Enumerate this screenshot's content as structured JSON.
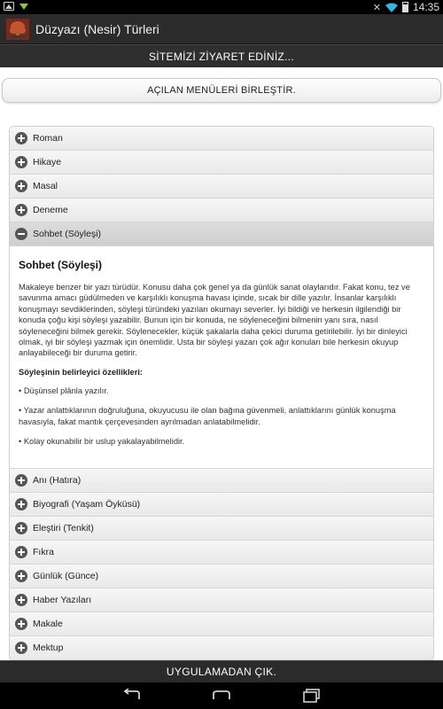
{
  "status_bar": {
    "time": "14:35",
    "icons": [
      "image-icon",
      "download-icon",
      "mute-icon",
      "wifi-icon",
      "battery-icon"
    ]
  },
  "action_bar": {
    "title": "Düzyazı (Nesir) Türleri",
    "icon": "app-logo-icon"
  },
  "visit_banner": {
    "label": "SİTEMİZİ ZİYARET EDİNİZ..."
  },
  "merge_button": {
    "label": "AÇILAN MENÜLERİ BİRLEŞTİR."
  },
  "accordion": {
    "items_before": [
      {
        "label": "Roman"
      },
      {
        "label": "Hikaye"
      },
      {
        "label": "Masal"
      },
      {
        "label": "Deneme"
      }
    ],
    "active_item": {
      "label": "Sohbet (Söyleşi)",
      "content": {
        "title": "Sohbet (Söyleşi)",
        "paragraph": "Makaleye benzer bir yazı türüdür. Konusu daha çok genel ya da günlük sanat olaylarıdır. Fakat konu, tez ve savunma amacı güdülmeden ve karşılıklı konuşma havası içinde, sıcak bir dille yazılır. İnsanlar karşılıklı konuşmayı sevdiklerinden, söyleşi türündeki yazıları okumayı severler. İyi bildiği ve herkesin ilgilendiği bir konuda çoğu kişi söyleşi yazabilir. Bunun için bir konuda, ne söyleneceğini bilmenin yanı sıra, nasıl söyleneceğini bilmek gerekir. Söylenecekler, küçük şakalarla daha çekici duruma getirilebilir. İyi bir dinleyici olmak, iyi bir söyleşi yazmak için önemlidir. Usta bir söyleşi yazarı çok ağır konuları bile herkesin okuyup anlayabileceği bir duruma getirir.",
        "subheading": "Söyleşinin belirleyici özellikleri:",
        "bullets": [
          "• Düşünsel plânla yazılır.",
          "• Yazar anlattıklarının doğruluğuna, okuyucusu ile olan bağına güvenmeli, anlattıklarını günlük konuşma havasıyla, fakat mantık çerçevesinden ayrılmadan anlatabilmelidir.",
          "• Kolay okunabilir bir uslup yakalayabilmelidir."
        ]
      }
    },
    "items_after": [
      {
        "label": "Anı (Hatıra)"
      },
      {
        "label": "Biyografi (Yaşam Öyküsü)"
      },
      {
        "label": "Eleştiri (Tenkit)"
      },
      {
        "label": "Fıkra"
      },
      {
        "label": "Günlük (Günce)"
      },
      {
        "label": "Haber Yazıları"
      },
      {
        "label": "Makale"
      },
      {
        "label": "Mektup"
      }
    ]
  },
  "exit_bar": {
    "label": "UYGULAMADAN ÇIK."
  },
  "nav_bar": {
    "buttons": [
      "back-icon",
      "home-icon",
      "recents-icon"
    ]
  },
  "colors": {
    "status_bar": "#000000",
    "action_bar": "#2b2b2b",
    "banner": "#2f2f2f",
    "accordion_header": "#ececec",
    "accordion_active": "#d5d5d5",
    "icon": "#555555"
  }
}
